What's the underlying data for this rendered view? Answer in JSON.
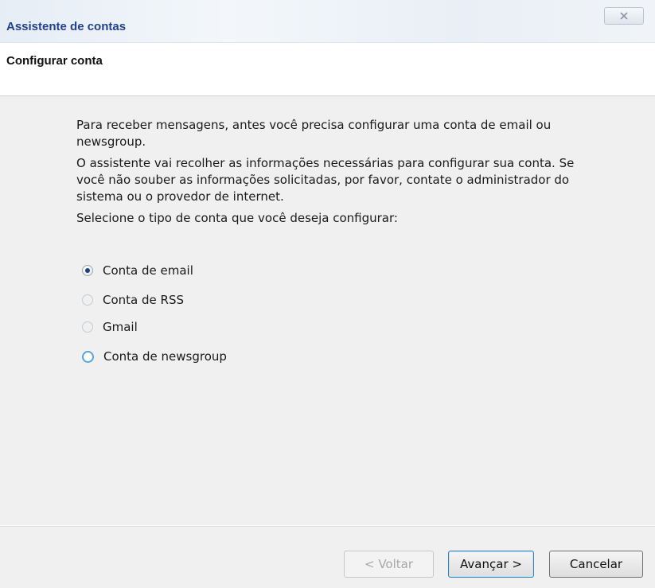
{
  "window": {
    "title": "Assistente de contas",
    "close_icon": "close-icon"
  },
  "header": {
    "title": "Configurar conta"
  },
  "content": {
    "paragraph1": "Para receber mensagens, antes você precisa configurar uma conta de email ou newsgroup.",
    "paragraph2": "O assistente vai recolher as informações necessárias para configurar sua conta. Se você não souber as informações solicitadas, por favor, contate o administrador do sistema ou o provedor de internet.",
    "prompt": "Selecione o tipo de conta que você deseja configurar:",
    "options": [
      {
        "label": "Conta de email",
        "state": "selected"
      },
      {
        "label": "Conta de RSS",
        "state": "disabled"
      },
      {
        "label": "Gmail",
        "state": "disabled"
      },
      {
        "label": "Conta de newsgroup",
        "state": "unselected"
      }
    ]
  },
  "footer": {
    "back_label": "< Voltar",
    "next_label": "Avançar >",
    "cancel_label": "Cancelar"
  },
  "colors": {
    "title_text": "#23408e",
    "content_bg": "#f0f0f0",
    "radio_focus": "#56a3e0"
  }
}
